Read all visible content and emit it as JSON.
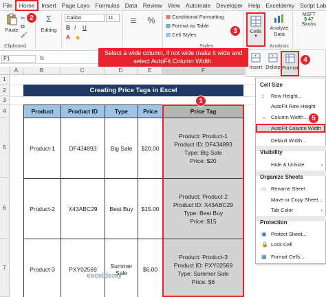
{
  "ribbon_tabs": [
    "File",
    "Home",
    "Insert",
    "Page Layo",
    "Formulas",
    "Data",
    "Review",
    "View",
    "Automate",
    "Developer",
    "Help",
    "Exceldemy",
    "Script Lab"
  ],
  "ribbon": {
    "paste": "Paste",
    "clipboard": "Clipboard",
    "editing": "Editing",
    "font_name": "Calibri",
    "font_size": "11",
    "bold": "B",
    "italic": "I",
    "underline": "U",
    "alignment": "≡",
    "number": "%",
    "conditional_formatting": "Conditional Formatting",
    "format_as_table": "Format as Table",
    "cell_styles": "Cell Styles",
    "styles": "Styles",
    "cells": "Cells",
    "analyze_data": "Analyze Data",
    "analysis": "Analysis",
    "msft": "MSFT",
    "msft_price": "$ 47",
    "stocks": "Stocks"
  },
  "formula_bar": {
    "name_box": "F1",
    "fx": "fx"
  },
  "grid": {
    "columns": [
      "A",
      "B",
      "C",
      "D",
      "E",
      "F"
    ],
    "rows": [
      "1",
      "2",
      "3",
      "4",
      "5",
      "6",
      "7"
    ]
  },
  "sheet": {
    "title": "Creating Price Tags in Excel",
    "headers": [
      "Product",
      "Product ID",
      "Type",
      "Price",
      "Price Tag"
    ],
    "rows": [
      {
        "product": "Product-1",
        "id": "DF434893",
        "type": "Big Sale",
        "price": "$20.00",
        "tag": [
          "Product: Product-1",
          "Product ID: DF434893",
          "Type: Big Sale",
          "Price: $20"
        ]
      },
      {
        "product": "Product-2",
        "id": "X43ABC29",
        "type": "Best Buy",
        "price": "$15.00",
        "tag": [
          "Product: Product-2",
          "Product ID: X43ABC29",
          "Type: Best Buy",
          "Price: $15"
        ]
      },
      {
        "product": "Product-3",
        "id": "PXY02569",
        "type": "Summer Sale",
        "price": "$6.00",
        "tag": [
          "Product: Product-3",
          "Product ID: PXY02569",
          "Type: Summer Sale",
          "Price: $6"
        ]
      }
    ]
  },
  "callout": "Select a wide column, if not wide make it wide and select AutoFit Column Width.",
  "cells_panel": {
    "insert": "Insert",
    "delete": "Delete",
    "format": "Format"
  },
  "format_menu": {
    "cell_size": "Cell Size",
    "row_height": "Row Height...",
    "autofit_row_height": "AutoFit Row Height",
    "column_width": "Column Width...",
    "autofit_column_width": "AutoFit Column Width",
    "default_width": "Default Width...",
    "visibility": "Visibility",
    "hide_unhide": "Hide & Unhide",
    "organize_sheets": "Organize Sheets",
    "rename_sheet": "Rename Sheet",
    "move_copy_sheet": "Move or Copy Sheet...",
    "tab_color": "Tab Color",
    "protection": "Protection",
    "protect_sheet": "Protect Sheet...",
    "lock_cell": "Lock Cell",
    "format_cells": "Format Cells..."
  },
  "steps": [
    "1",
    "2",
    "3",
    "4",
    "5"
  ],
  "watermark": "exceldemy",
  "colors": {
    "accent_red": "#e8222a",
    "title_navy": "#1f3864",
    "header_blue": "#9dc3e6",
    "tag_gray": "#d3d3d3"
  }
}
